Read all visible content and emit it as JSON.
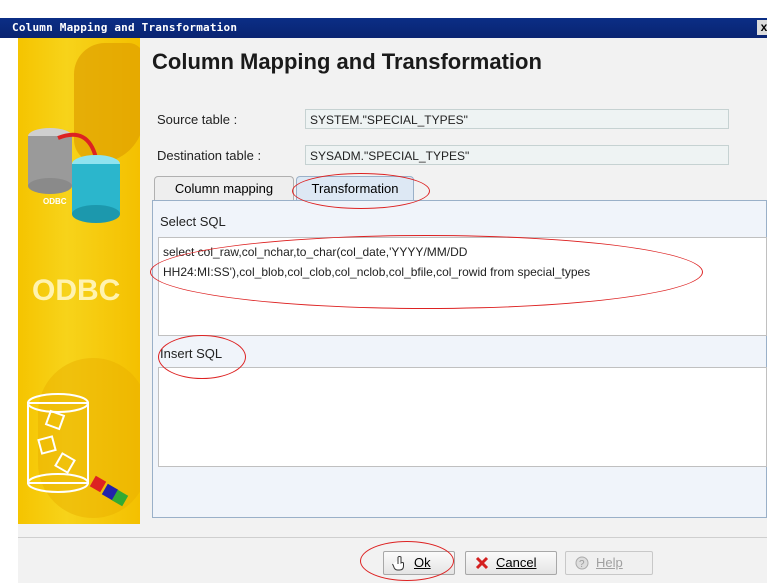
{
  "window": {
    "title": "Column Mapping and Transformation",
    "close_glyph": "x"
  },
  "banner": {
    "logo_text": "ODBC",
    "small_text": "ODBC"
  },
  "page": {
    "heading": "Column Mapping and Transformation"
  },
  "source": {
    "label": "Source table :",
    "value": "SYSTEM.\"SPECIAL_TYPES\""
  },
  "destination": {
    "label": "Destination table :",
    "value": "SYSADM.\"SPECIAL_TYPES\""
  },
  "tabs": [
    {
      "label": "Column mapping",
      "active": false
    },
    {
      "label": "Transformation",
      "active": true
    }
  ],
  "select_sql": {
    "label": "Select SQL",
    "lines": [
      "select col_raw,col_nchar,to_char(col_date,'YYYY/MM/DD",
      "HH24:MI:SS'),col_blob,col_clob,col_nclob,col_bfile,col_rowid from special_types"
    ]
  },
  "insert_sql": {
    "label": "Insert SQL",
    "value": ""
  },
  "buttons": {
    "ok": "Ok",
    "cancel": "Cancel",
    "help": "Help"
  },
  "colors": {
    "titlebar": "#0b2e86",
    "banner": "#f5c400",
    "annotation": "#dd2222"
  }
}
